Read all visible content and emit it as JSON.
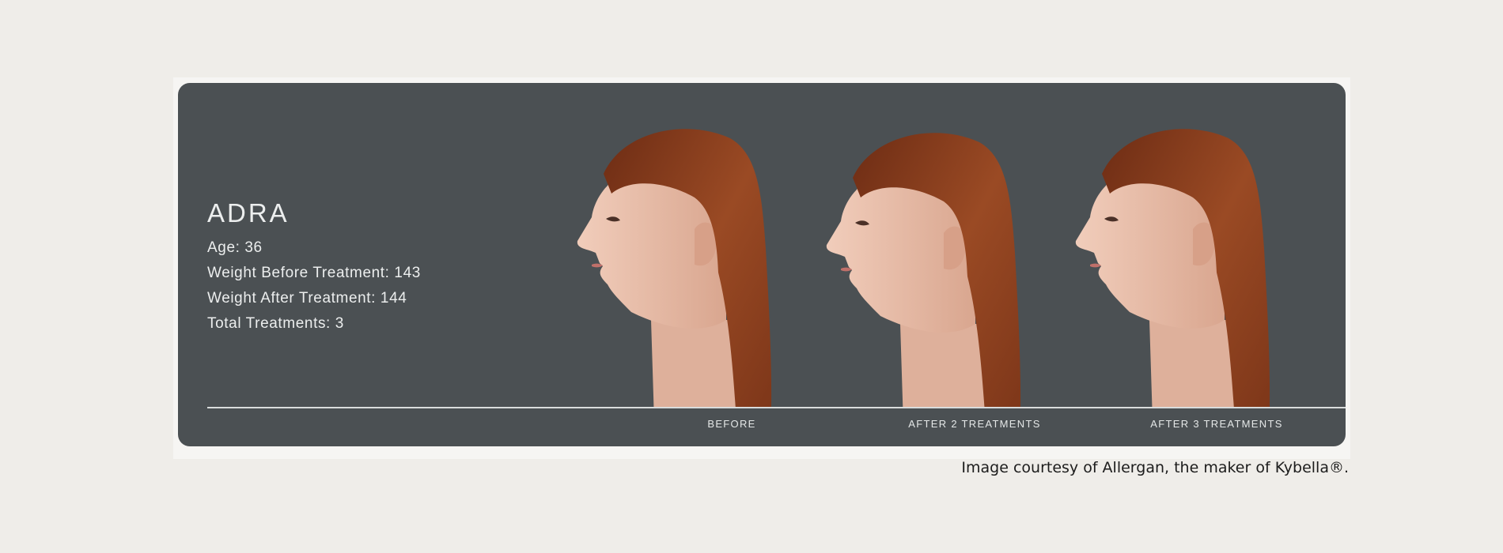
{
  "patient": {
    "name": "ADRA",
    "age": "Age: 36",
    "weight_before": "Weight Before Treatment: 143",
    "weight_after": "Weight After Treatment: 144",
    "total_treatments": "Total Treatments: 3"
  },
  "photos": [
    {
      "caption": "BEFORE",
      "icon": "profile-before-photo"
    },
    {
      "caption": "AFTER 2 TREATMENTS",
      "icon": "profile-after-2-photo"
    },
    {
      "caption": "AFTER 3 TREATMENTS",
      "icon": "profile-after-3-photo"
    }
  ],
  "credit": "Image courtesy of Allergan, the maker of Kybella®.",
  "colors": {
    "page_bg": "#efede9",
    "card_bg": "#4b5053",
    "hair": "#8a3e1e",
    "skin": "#e8bba6"
  }
}
